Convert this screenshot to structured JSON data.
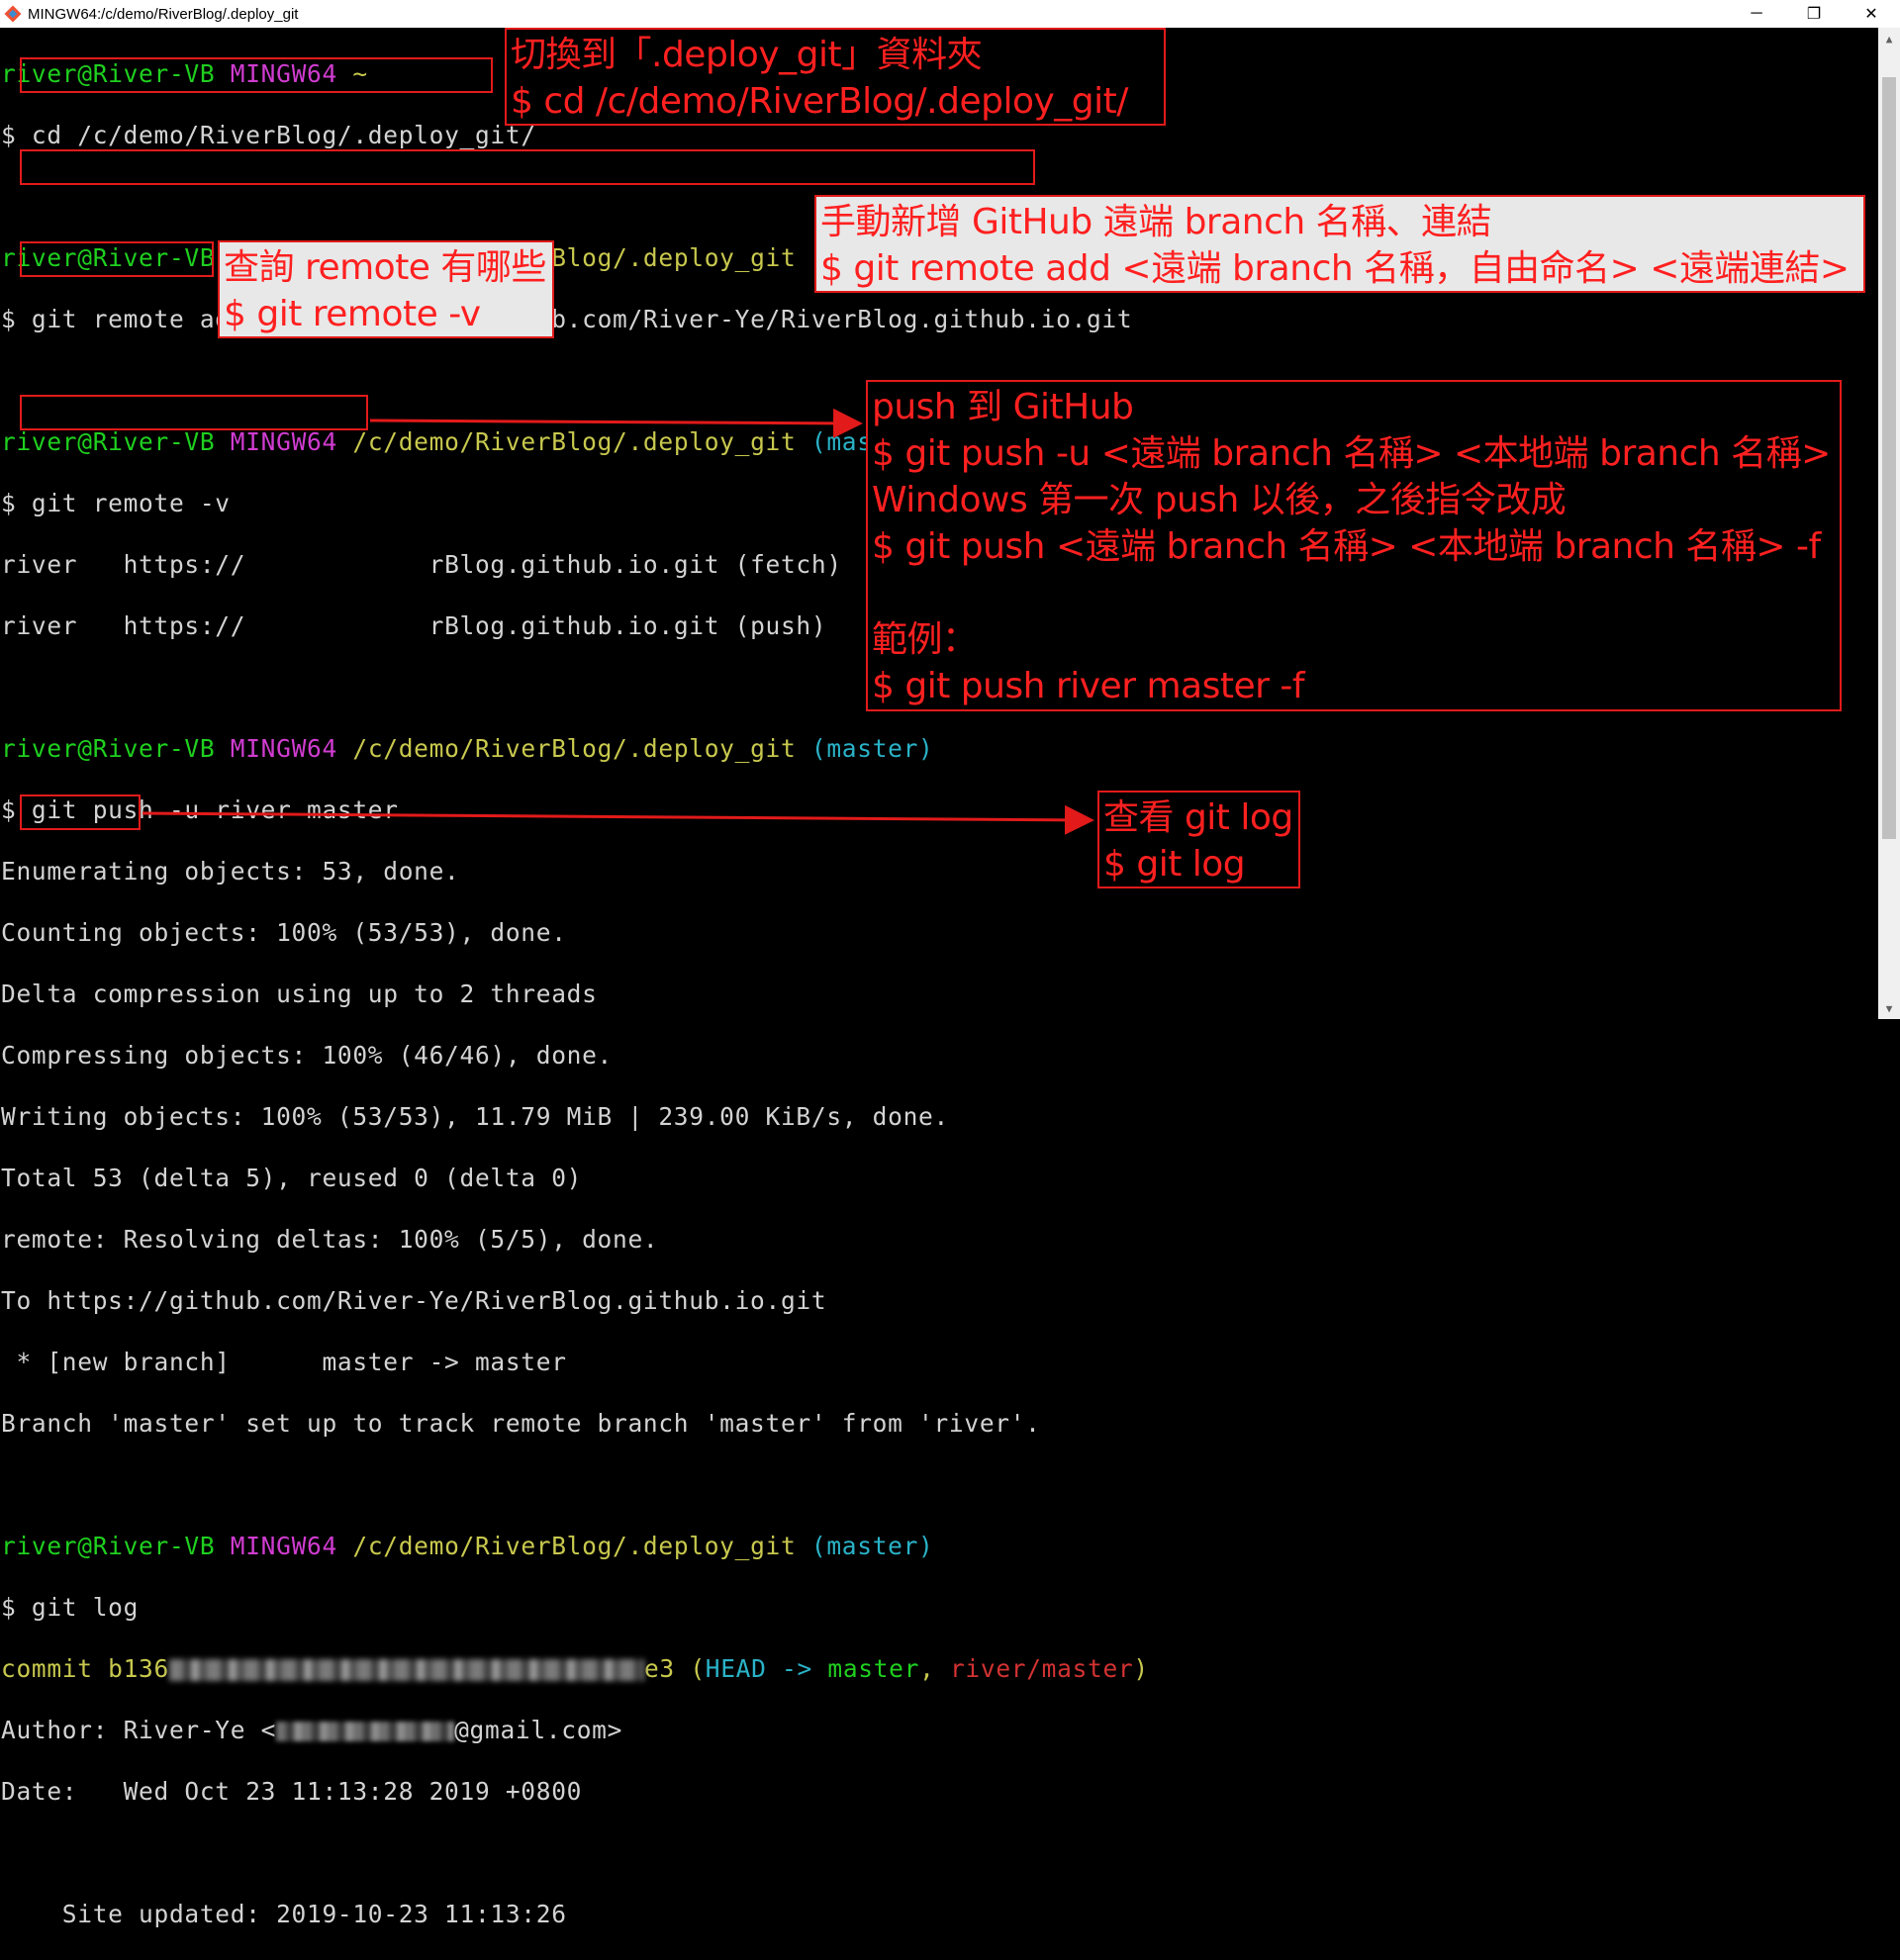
{
  "window": {
    "title": "MINGW64:/c/demo/RiverBlog/.deploy_git",
    "icon": "git-bash-icon",
    "minimize": "─",
    "maximize": "❐",
    "close": "✕"
  },
  "prompt": {
    "user": "river@River-VB",
    "env": "MINGW64",
    "tilde": "~",
    "path": "/c/demo/RiverBlog/.deploy_git",
    "branch": "(master)"
  },
  "terminal": {
    "cmd_cd": "cd /c/demo/RiverBlog/.deploy_git/",
    "cmd_remote_add": "git remote add river https://github.com/River-Ye/RiverBlog.github.io.git",
    "cmd_remote_v": "git remote -v",
    "remote_fetch_a": "river   https://",
    "remote_fetch_b": "rBlog.github.io.git (fetch)",
    "remote_push_a": "river   https://",
    "remote_push_b": "rBlog.github.io.git (push)",
    "cmd_push": "git push -u river master",
    "push_out": [
      "Enumerating objects: 53, done.",
      "Counting objects: 100% (53/53), done.",
      "Delta compression using up to 2 threads",
      "Compressing objects: 100% (46/46), done.",
      "Writing objects: 100% (53/53), 11.79 MiB | 239.00 KiB/s, done.",
      "Total 53 (delta 5), reused 0 (delta 0)",
      "remote: Resolving deltas: 100% (5/5), done.",
      "To https://github.com/River-Ye/RiverBlog.github.io.git",
      " * [new branch]      master -> master",
      "Branch 'master' set up to track remote branch 'master' from 'river'."
    ],
    "cmd_log": "git log",
    "commit_prefix": "commit b136",
    "commit_suffix": "e3",
    "commit_head": "(HEAD -> ",
    "commit_master": "master",
    "commit_sep": ", ",
    "commit_remote": "river/master",
    "commit_close": ")",
    "author_prefix": "Author: River-Ye <",
    "author_suffix": "@gmail.com>",
    "date_line": "Date:   Wed Oct 23 11:13:28 2019 +0800",
    "message_line": "    Site updated: 2019-10-23 11:13:26"
  },
  "annotations": {
    "cd_note": "切換到「.deploy_git」資料夾\n$ cd /c/demo/RiverBlog/.deploy_git/",
    "remote_add_note": "手動新增 GitHub 遠端 branch 名稱、連結\n$ git remote add <遠端 branch 名稱，自由命名> <遠端連結>",
    "remote_v_note": "查詢 remote 有哪些\n$ git remote -v",
    "push_note": "push 到 GitHub\n$ git push -u <遠端 branch 名稱> <本地端 branch 名稱>\nWindows 第一次 push 以後，之後指令改成\n$ git push <遠端 branch 名稱> <本地端 branch 名稱> -f\n\n範例：\n$ git push river master -f",
    "log_note": "查看 git log\n$ git log"
  },
  "colors": {
    "annotation": "#ff2020",
    "prompt_user": "#1fd01f",
    "prompt_env": "#d03cd0",
    "prompt_path": "#c8c84e",
    "prompt_branch": "#2ab3c8"
  }
}
